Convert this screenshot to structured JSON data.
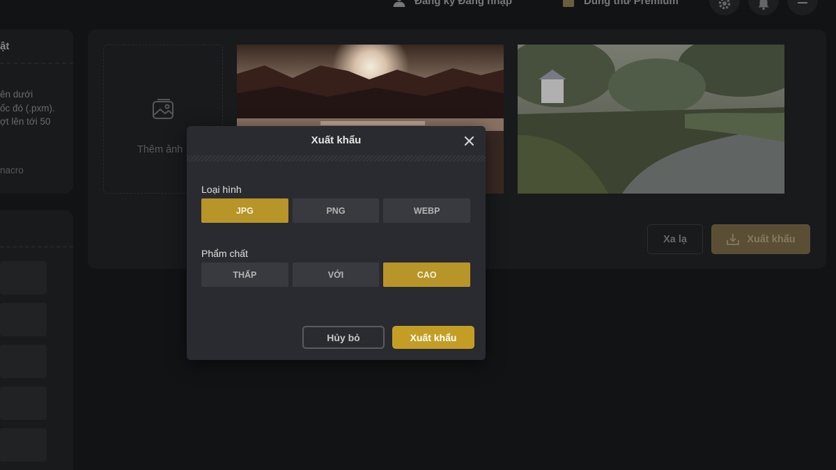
{
  "topbar": {
    "auth_label": "Đăng ký Đăng nhập",
    "premium_label": "Dùng thử Premium"
  },
  "sidebar": {
    "card_title": "ật",
    "desc_lines": [
      "ên dưới",
      "ốc đó (.pxm).",
      "ợt lên tới 50"
    ],
    "footer": "nacro"
  },
  "main": {
    "add_image_label": "Thêm ảnh",
    "secondary_button": "Xa lạ",
    "export_button": "Xuất khẩu"
  },
  "modal": {
    "title": "Xuất khẩu",
    "type_label": "Loại hình",
    "type_options": [
      "JPG",
      "PNG",
      "WEBP"
    ],
    "type_selected": "JPG",
    "quality_label": "Phẩm chất",
    "quality_options": [
      "THẤP",
      "VỚI",
      "CAO"
    ],
    "quality_selected": "CAO",
    "cancel_label": "Hủy bỏ",
    "confirm_label": "Xuất khẩu"
  },
  "colors": {
    "accent": "#c49e24",
    "background": "#131415",
    "panel": "#1b1c1e",
    "modal": "#2a2b30"
  },
  "icons": [
    "user-icon",
    "gift-icon",
    "gear-icon",
    "bell-icon",
    "menu-icon",
    "image-add-icon",
    "download-icon",
    "close-icon"
  ]
}
